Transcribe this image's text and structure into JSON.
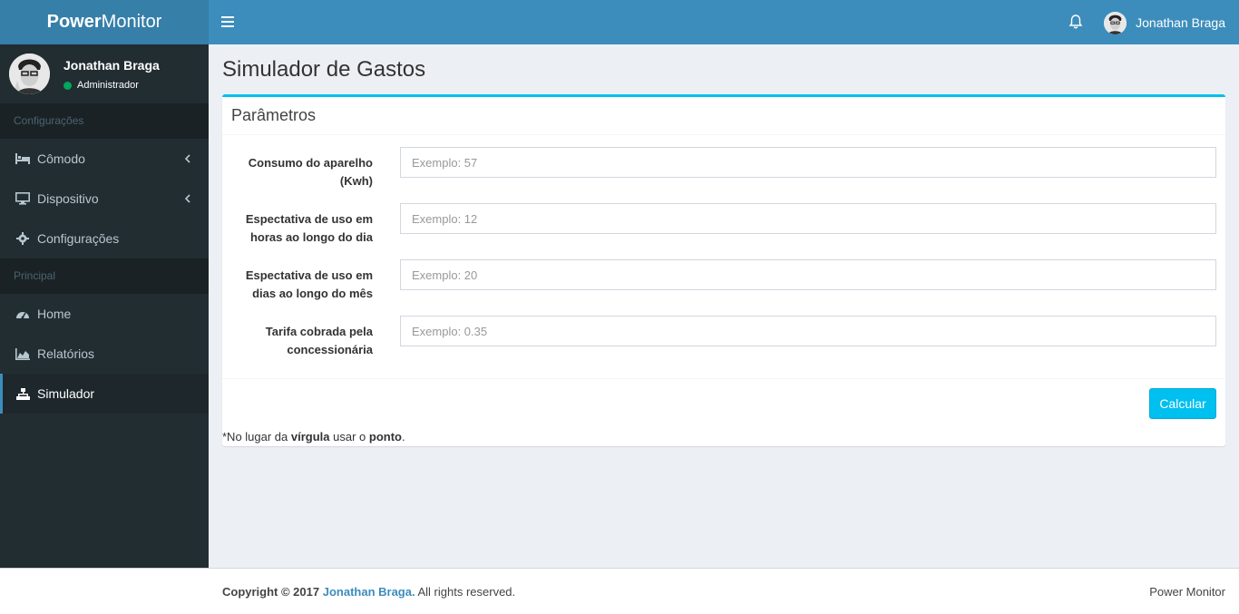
{
  "logo": {
    "bold": "Power",
    "rest": "Monitor"
  },
  "header": {
    "user_name": "Jonathan Braga"
  },
  "sidebar": {
    "user": {
      "name": "Jonathan Braga",
      "role": "Administrador"
    },
    "sections": [
      {
        "title": "Configurações",
        "items": [
          {
            "label": "Cômodo",
            "icon": "bed-icon",
            "has_submenu": true
          },
          {
            "label": "Dispositivo",
            "icon": "desktop-icon",
            "has_submenu": true
          },
          {
            "label": "Configurações",
            "icon": "gear-icon",
            "has_submenu": false
          }
        ]
      },
      {
        "title": "Principal",
        "items": [
          {
            "label": "Home",
            "icon": "dashboard-icon",
            "has_submenu": false
          },
          {
            "label": "Relatórios",
            "icon": "area-chart-icon",
            "has_submenu": false
          },
          {
            "label": "Simulador",
            "icon": "sitemap-icon",
            "has_submenu": false,
            "active": true
          }
        ]
      }
    ]
  },
  "page": {
    "title": "Simulador de Gastos"
  },
  "form": {
    "box_title": "Parâmetros",
    "fields": [
      {
        "label": "Consumo do aparelho (Kwh)",
        "placeholder": "Exemplo: 57",
        "value": ""
      },
      {
        "label": "Espectativa de uso em horas ao longo do dia",
        "placeholder": "Exemplo: 12",
        "value": ""
      },
      {
        "label": "Espectativa de uso em dias ao longo do mês",
        "placeholder": "Exemplo: 20",
        "value": ""
      },
      {
        "label": "Tarifa cobrada pela concessionária",
        "placeholder": "Exemplo: 0.35",
        "value": ""
      }
    ],
    "submit_label": "Calcular",
    "note": {
      "prefix": "*No lugar da ",
      "word1": "vírgula",
      "middle": " usar o ",
      "word2": "ponto",
      "suffix": "."
    }
  },
  "footer": {
    "copyright_prefix": "Copyright © 2017",
    "author": "Jonathan Braga.",
    "rights": "All rights reserved.",
    "brand": "Power Monitor"
  },
  "colors": {
    "accent": "#3c8dbc",
    "logo_bg": "#367fa9",
    "sidebar_bg": "#222d32",
    "button": "#00c0ef",
    "status_online": "#00a65a"
  }
}
